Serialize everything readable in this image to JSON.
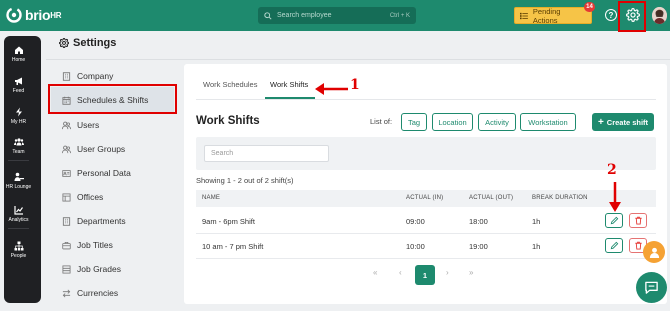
{
  "app": {
    "logo_text": "brio",
    "logo_sup": "HR",
    "search_placeholder": "Search employee",
    "search_shortcut": "Ctrl + K",
    "pending_label": "Pending Actions",
    "pending_count": "14",
    "help_glyph": "?"
  },
  "leftnav": [
    {
      "label": "Home",
      "icon": "home-icon"
    },
    {
      "label": "Feed",
      "icon": "megaphone-icon"
    },
    {
      "label": "My HR",
      "icon": "lightning-icon"
    },
    {
      "label": "Team",
      "icon": "team-icon"
    },
    {
      "label": "HR Lounge",
      "icon": "person-desk-icon"
    },
    {
      "label": "Analytics",
      "icon": "chart-icon"
    },
    {
      "label": "People",
      "icon": "org-chart-icon"
    }
  ],
  "page": {
    "title": "Settings"
  },
  "sidebar": [
    {
      "label": "Company",
      "icon": "building-icon"
    },
    {
      "label": "Schedules & Shifts",
      "icon": "calendar-icon"
    },
    {
      "label": "Users",
      "icon": "users-icon"
    },
    {
      "label": "User Groups",
      "icon": "user-group-icon"
    },
    {
      "label": "Personal Data",
      "icon": "id-card-icon"
    },
    {
      "label": "Offices",
      "icon": "office-icon"
    },
    {
      "label": "Departments",
      "icon": "department-icon"
    },
    {
      "label": "Job Titles",
      "icon": "briefcase-icon"
    },
    {
      "label": "Job Grades",
      "icon": "grades-icon"
    },
    {
      "label": "Currencies",
      "icon": "exchange-icon"
    }
  ],
  "tabs": [
    {
      "label": "Work Schedules"
    },
    {
      "label": "Work Shifts"
    }
  ],
  "content": {
    "title": "Work Shifts",
    "list_of": "List of:",
    "chips": [
      "Tag",
      "Location",
      "Activity",
      "Workstation"
    ],
    "create_label": "Create shift",
    "search_placeholder": "Search",
    "showing": "Showing 1 - 2 out of 2 shift(s)",
    "columns": [
      "NAME",
      "ACTUAL (IN)",
      "ACTUAL (OUT)",
      "BREAK DURATION"
    ],
    "rows": [
      {
        "name": "9am - 6pm Shift",
        "in": "09:00",
        "out": "18:00",
        "break": "1h"
      },
      {
        "name": "10 am - 7 pm Shift",
        "in": "10:00",
        "out": "19:00",
        "break": "1h"
      }
    ],
    "pager": {
      "first": "«",
      "prev": "‹",
      "current": "1",
      "next": "›",
      "last": "»"
    }
  },
  "annotations": {
    "step1": "1",
    "step2": "2",
    "highlight_color": "#e00000"
  },
  "colors": {
    "brand": "#1e8a6e",
    "pending": "#f6c447",
    "nav_bg": "#1f2023"
  }
}
